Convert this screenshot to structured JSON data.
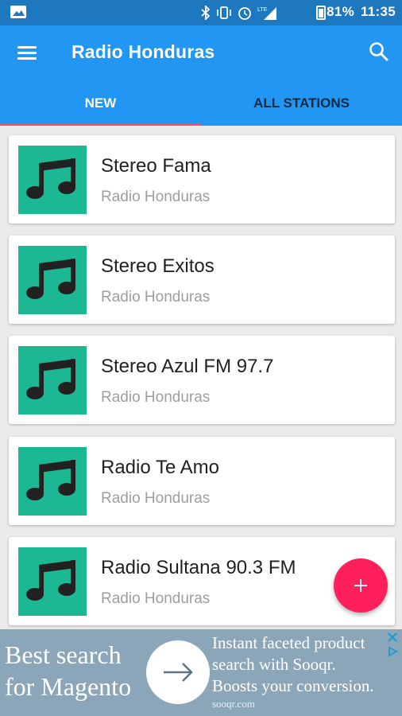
{
  "status_bar": {
    "battery_percent": "81%",
    "time": "11:35",
    "icons": [
      "image-icon",
      "bluetooth-icon",
      "vibrate-icon",
      "alarm-icon",
      "signal-icon"
    ]
  },
  "app_bar": {
    "title": "Radio Honduras",
    "menu_icon": "menu-icon",
    "search_icon": "search-icon"
  },
  "tabs": [
    {
      "label": "NEW",
      "active": true
    },
    {
      "label": "ALL STATIONS",
      "active": false
    }
  ],
  "stations": [
    {
      "name": "Stereo Fama",
      "subtitle": "Radio Honduras"
    },
    {
      "name": "Stereo Exitos",
      "subtitle": "Radio Honduras"
    },
    {
      "name": "Stereo Azul FM 97.7",
      "subtitle": "Radio Honduras"
    },
    {
      "name": "Radio Te Amo",
      "subtitle": "Radio Honduras"
    },
    {
      "name": "Radio Sultana 90.3 FM",
      "subtitle": "Radio Honduras"
    }
  ],
  "fab": {
    "icon": "plus-icon"
  },
  "ad": {
    "left_line1": "Best search",
    "left_line2": "for Magento",
    "right_line1": "Instant faceted product",
    "right_line2": "search with Sooqr.",
    "right_line3": "Boosts your conversion.",
    "domain": "sooqr.com"
  },
  "colors": {
    "status_bar": "#1e78bf",
    "app_bar": "#2196f3",
    "tab_indicator": "#ff4b5c",
    "thumb_bg": "#1bb893",
    "fab": "#ff1f5a",
    "ad_bg": "#8ba6b8"
  }
}
